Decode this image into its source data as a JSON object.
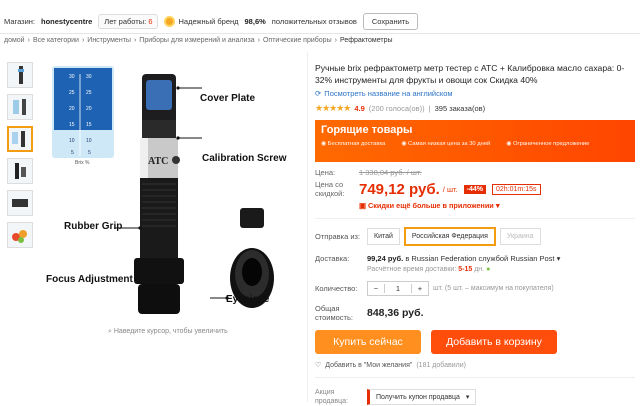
{
  "topbar": {
    "shop_label": "Магазин:",
    "shop_name": "honestycentre",
    "years_text": "Лет работы:",
    "years_num": "6",
    "brand_text": "Надежный бренд",
    "feedback_pct": "98,6%",
    "feedback_text": "положительных отзывов",
    "save_button": "Сохранить"
  },
  "breadcrumbs": [
    "домой",
    "Все категории",
    "Инструменты",
    "Приборы для измерений и анализа",
    "Оптические приборы",
    "Рефрактометры"
  ],
  "gallery": {
    "labels": {
      "cover_plate": "Cover Plate",
      "calibration_screw": "Calibration Screw",
      "rubber_grip": "Rubber Grip",
      "focus_adjustment": "Focus Adjustment",
      "eyepiece": "Eyepiece",
      "atc": "ATC",
      "brix": "Brix %"
    },
    "hint": "Наведите курсор, чтобы увеличить"
  },
  "product": {
    "title": "Ручные brix рефрактометр метр тестер с ATC + Калибровка масло сахара: 0-32% инструменты для фрукты и овощи сок Скидка 40%",
    "translate_link": "Посмотреть название на английском",
    "rating": "4.9",
    "votes": "(200 голоса(ов))",
    "orders": "395 заказа(ов)"
  },
  "hot": {
    "title": "Горящие товары",
    "features": [
      "Бесплатная доставка",
      "Самая низкая цена за 30 дней",
      "Ограниченное предложение"
    ]
  },
  "price": {
    "label": "Цена:",
    "old": "1 338,04 руб. / шт.",
    "sale_label": "Цена со скидкой:",
    "new": "749,12 руб.",
    "unit": "/ шт.",
    "discount": "-44%",
    "timer": "02h:01m:15s",
    "coupons": "Скидки ещё больше в приложении"
  },
  "options": {
    "ship_from_label": "Отправка из:",
    "ship_from": [
      "Китай",
      "Российская Федерация",
      "Украина"
    ],
    "delivery_label": "Доставка:",
    "delivery_price": "99,24 руб.",
    "delivery_to": "в Russian Federation службой Russian Post",
    "delivery_time_label": "Расчётное время доставки:",
    "delivery_time": "5-15",
    "delivery_time_unit": "дн.",
    "qty_label": "Количество:",
    "qty_value": "1",
    "qty_note": "шт. (5 шт. – максимум на покупателя)",
    "total_label": "Общая стоимость:",
    "total": "848,36 руб."
  },
  "actions": {
    "buy": "Купить сейчас",
    "cart": "Добавить в корзину",
    "wish": "Добавить в \"Мои желания\"",
    "wish_count": "(181 добавили)"
  },
  "promo": {
    "label": "Акция продавца:",
    "select": "Получить купон продавца"
  }
}
